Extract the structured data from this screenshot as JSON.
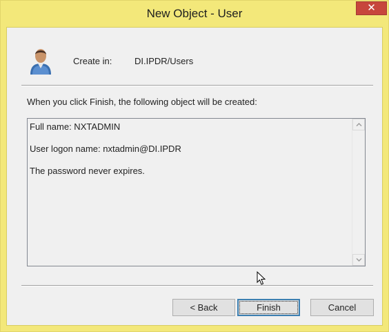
{
  "window": {
    "title": "New Object - User",
    "close_label": "✕"
  },
  "header": {
    "icon": "user-icon",
    "create_in_label": "Create in:",
    "create_in_value": "DI.IPDR/Users"
  },
  "body": {
    "info_text": "When you click Finish, the following object will be created:",
    "summary_lines": [
      "Full name: NXTADMIN",
      "User logon name: nxtadmin@DI.IPDR",
      "The password never expires."
    ]
  },
  "buttons": {
    "back": "< Back",
    "finish": "Finish",
    "cancel": "Cancel"
  },
  "colors": {
    "title_bar": "#f3e87a",
    "close_button": "#c7463c",
    "default_button_border": "#3c7fb1"
  }
}
